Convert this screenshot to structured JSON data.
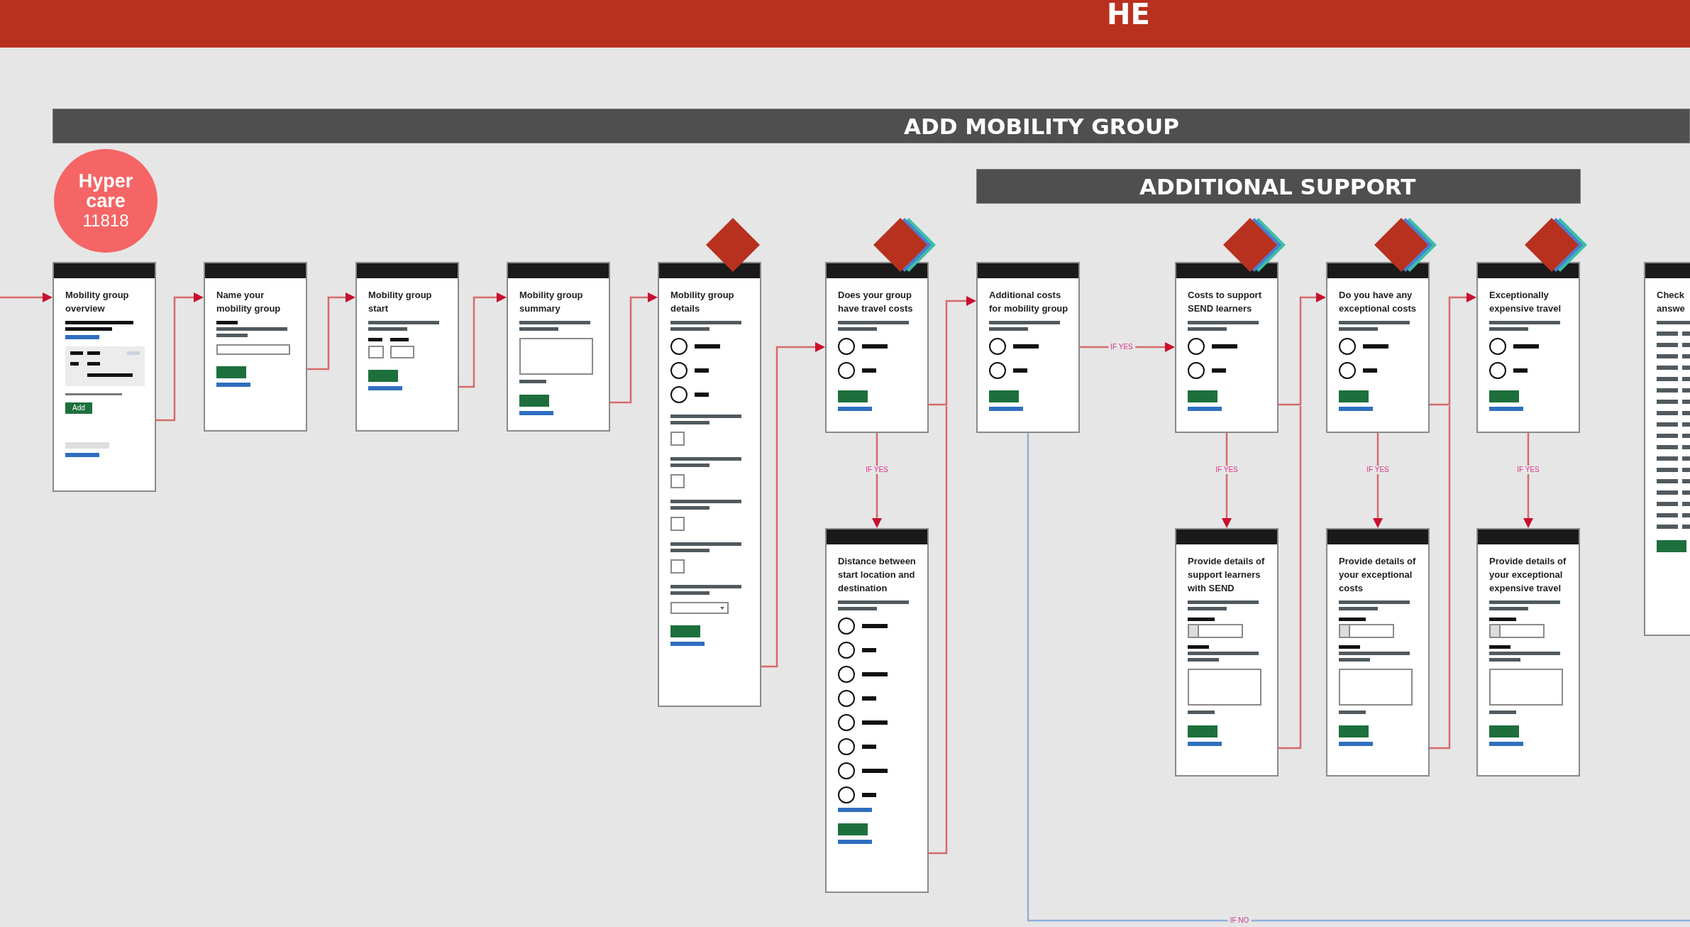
{
  "banner": {
    "title": "HE"
  },
  "section": {
    "title": "ADD MOBILITY GROUP"
  },
  "subsection": {
    "title": "ADDITIONAL SUPPORT"
  },
  "badge": {
    "title": "Hyper care",
    "number": "11818"
  },
  "screens": [
    {
      "title": "Mobility group overview",
      "content": [
        {
          "kind": "black-lines"
        },
        {
          "kind": "link"
        },
        {
          "kind": "panel"
        },
        {
          "kind": "caption"
        },
        {
          "kind": "add-button",
          "label": "Add"
        },
        {
          "kind": "tag"
        },
        {
          "kind": "link"
        }
      ]
    },
    {
      "title": "Name your mobility group",
      "content": [
        {
          "kind": "lines-caption"
        },
        {
          "kind": "text-input"
        },
        {
          "kind": "button"
        },
        {
          "kind": "link"
        }
      ]
    },
    {
      "title": "Mobility group start",
      "content": [
        {
          "kind": "lines"
        },
        {
          "kind": "date-input"
        },
        {
          "kind": "button"
        },
        {
          "kind": "link"
        }
      ]
    },
    {
      "title": "Mobility group summary",
      "content": [
        {
          "kind": "lines"
        },
        {
          "kind": "summary-box"
        },
        {
          "kind": "button"
        },
        {
          "kind": "link"
        }
      ]
    },
    {
      "title": "Mobility group details",
      "decision": {
        "kind": "single"
      },
      "content": [
        {
          "kind": "lines"
        },
        {
          "kind": "radio-long"
        },
        {
          "kind": "radio-short"
        },
        {
          "kind": "radio-short"
        },
        {
          "kind": "lines"
        },
        {
          "kind": "checkbox",
          "checked": false
        },
        {
          "kind": "lines"
        },
        {
          "kind": "checkbox",
          "checked": false
        },
        {
          "kind": "lines"
        },
        {
          "kind": "checkbox",
          "checked": false
        },
        {
          "kind": "lines"
        },
        {
          "kind": "checkbox",
          "checked": false
        },
        {
          "kind": "lines"
        },
        {
          "kind": "select"
        },
        {
          "kind": "button"
        },
        {
          "kind": "link"
        }
      ]
    },
    {
      "title": "Does your group have travel costs",
      "decision": {
        "kind": "stack"
      },
      "content": [
        {
          "kind": "lines"
        },
        {
          "kind": "radio-long"
        },
        {
          "kind": "radio-short"
        },
        {
          "kind": "button"
        },
        {
          "kind": "link"
        }
      ]
    },
    {
      "title": "Additional costs for mobility group",
      "content": [
        {
          "kind": "lines"
        },
        {
          "kind": "radio-long"
        },
        {
          "kind": "radio-short"
        },
        {
          "kind": "button"
        },
        {
          "kind": "link"
        }
      ]
    },
    {
      "title": "Costs to support SEND learners",
      "decision": {
        "kind": "stack"
      },
      "content": [
        {
          "kind": "lines"
        },
        {
          "kind": "radio-long"
        },
        {
          "kind": "radio-short"
        },
        {
          "kind": "button"
        },
        {
          "kind": "link"
        }
      ]
    },
    {
      "title": "Do you have any exceptional costs",
      "decision": {
        "kind": "stack"
      },
      "content": [
        {
          "kind": "lines"
        },
        {
          "kind": "radio-long"
        },
        {
          "kind": "radio-short"
        },
        {
          "kind": "button"
        },
        {
          "kind": "link"
        }
      ]
    },
    {
      "title": "Exceptionally expensive travel",
      "decision": {
        "kind": "stack"
      },
      "content": [
        {
          "kind": "lines"
        },
        {
          "kind": "radio-long"
        },
        {
          "kind": "radio-short"
        },
        {
          "kind": "button"
        },
        {
          "kind": "link"
        }
      ]
    },
    {
      "title": "Check answe",
      "content": [
        {
          "kind": "line"
        },
        {
          "kind": "summary-row"
        },
        {
          "kind": "summary-row"
        },
        {
          "kind": "summary-row"
        },
        {
          "kind": "summary-row"
        },
        {
          "kind": "summary-row"
        },
        {
          "kind": "summary-row"
        },
        {
          "kind": "summary-row"
        },
        {
          "kind": "summary-row"
        },
        {
          "kind": "summary-row"
        },
        {
          "kind": "summary-row"
        },
        {
          "kind": "summary-row"
        },
        {
          "kind": "summary-row"
        },
        {
          "kind": "summary-row"
        },
        {
          "kind": "summary-row"
        },
        {
          "kind": "summary-row"
        },
        {
          "kind": "summary-row"
        },
        {
          "kind": "summary-row"
        },
        {
          "kind": "summary-row"
        },
        {
          "kind": "button"
        }
      ]
    },
    {
      "title": "Distance between start location and destination",
      "content": [
        {
          "kind": "lines"
        },
        {
          "kind": "radio-long"
        },
        {
          "kind": "radio-short"
        },
        {
          "kind": "radio-long"
        },
        {
          "kind": "radio-short"
        },
        {
          "kind": "radio-long"
        },
        {
          "kind": "radio-short"
        },
        {
          "kind": "radio-long"
        },
        {
          "kind": "radio-short"
        },
        {
          "kind": "link"
        },
        {
          "kind": "button"
        },
        {
          "kind": "link"
        }
      ]
    },
    {
      "title": "Provide details of support learners with SEND",
      "content": [
        {
          "kind": "lines"
        },
        {
          "kind": "currency-input"
        },
        {
          "kind": "lines-caption"
        },
        {
          "kind": "summary-box"
        },
        {
          "kind": "button"
        },
        {
          "kind": "link"
        }
      ]
    },
    {
      "title": "Provide details of your exceptional costs",
      "content": [
        {
          "kind": "lines"
        },
        {
          "kind": "currency-input"
        },
        {
          "kind": "lines-caption"
        },
        {
          "kind": "summary-box"
        },
        {
          "kind": "button"
        },
        {
          "kind": "link"
        }
      ]
    },
    {
      "title": "Provide details of your exceptional expensive travel",
      "content": [
        {
          "kind": "lines"
        },
        {
          "kind": "currency-input"
        },
        {
          "kind": "lines-caption"
        },
        {
          "kind": "summary-box"
        },
        {
          "kind": "button"
        },
        {
          "kind": "link"
        }
      ]
    }
  ],
  "flow_labels": [
    {
      "text": "IF YES",
      "kind": "yes"
    },
    {
      "text": "IF YES",
      "kind": "yes"
    },
    {
      "text": "IF YES",
      "kind": "yes"
    },
    {
      "text": "IF YES",
      "kind": "yes"
    },
    {
      "text": "IF YES",
      "kind": "yes"
    },
    {
      "text": "IF NO",
      "kind": "no"
    }
  ]
}
